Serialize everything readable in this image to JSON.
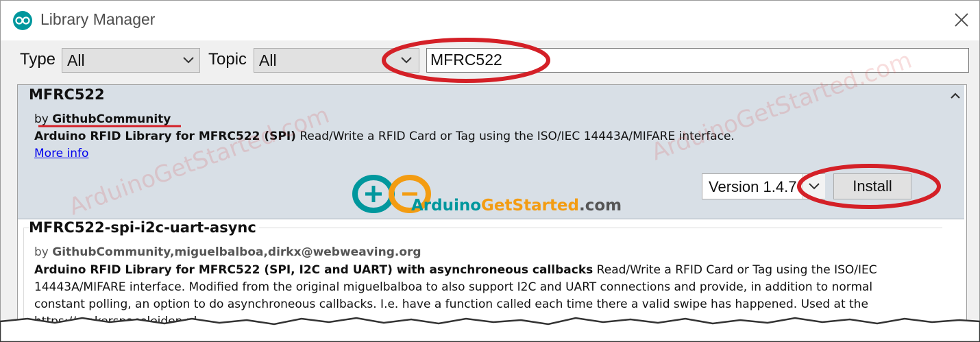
{
  "window": {
    "title": "Library Manager"
  },
  "filters": {
    "type_label": "Type",
    "type_value": "All",
    "topic_label": "Topic",
    "topic_value": "All",
    "search_value": "MFRC522"
  },
  "libraries": [
    {
      "name": "MFRC522",
      "by_prefix": "by",
      "author": "GithubCommunity",
      "desc_bold": "Arduino RFID Library for MFRC522 (SPI)",
      "desc_rest": " Read/Write a RFID Card or Tag using the ISO/IEC 14443A/MIFARE interface.",
      "more_info": "More info",
      "version": "Version 1.4.7",
      "install_label": "Install"
    },
    {
      "name": "MFRC522-spi-i2c-uart-async",
      "by_prefix": "by",
      "author": "GithubCommunity,miguelbalboa,dirkx@webweaving.org",
      "desc_bold": "Arduino RFID Library for MFRC522 (SPI, I2C and UART) with asynchroneous callbacks",
      "desc_rest": " Read/Write a RFID Card or Tag using the ISO/IEC 14443A/MIFARE interface. Modified from the original miguelbalboa to also support I2C and UART connections and provide, in addition to normal constant polling, an option to do asynchroneous callbacks. I.e. have a function called each time there a valid swipe has happened. Used at the https://makerspaceleiden.nl"
    }
  ],
  "watermark": {
    "text": "ArduinoGetStarted.com",
    "logo_part1": "Arduino",
    "logo_part2": "GetStarted",
    "logo_part3": ".com"
  },
  "colors": {
    "highlight_red": "#d42027",
    "selected_row": "#d8dfe6",
    "link": "#0000ee",
    "logo_teal": "#00979d",
    "logo_orange": "#f39c12"
  }
}
